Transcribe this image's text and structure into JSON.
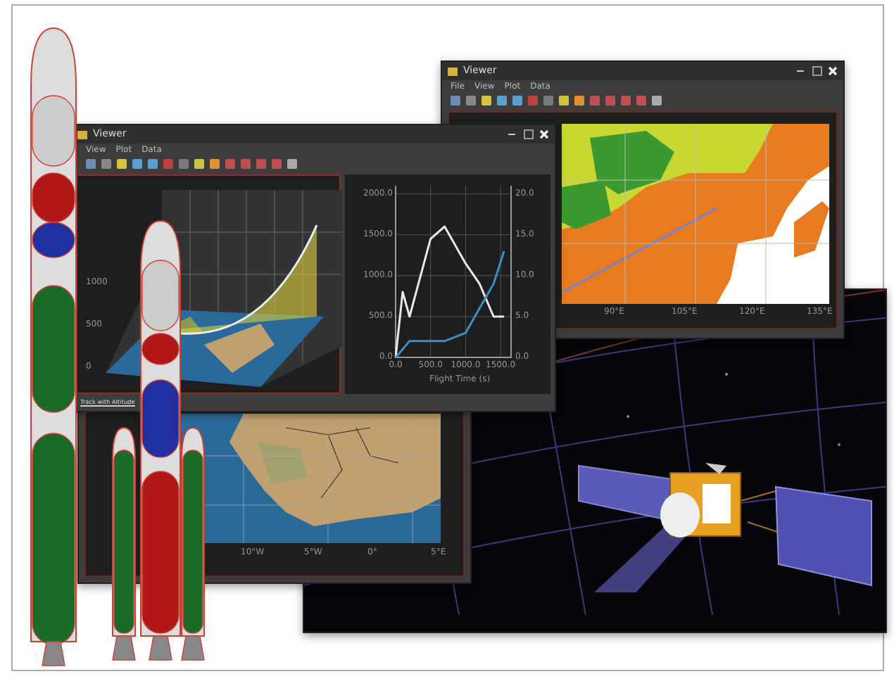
{
  "back_window": {
    "title": "Viewer",
    "menu": [
      "File",
      "View",
      "Plot",
      "Data"
    ],
    "map_xticks": [
      "90°E",
      "105°E",
      "120°E",
      "135°E"
    ]
  },
  "map_window": {
    "map_xticks": [
      "10°W",
      "5°W",
      "0°",
      "5°E"
    ]
  },
  "front_window": {
    "title": "Viewer",
    "menu": [
      "View",
      "Plot",
      "Data"
    ],
    "surface_plot": {
      "zticks": [
        "1000",
        "500",
        "0"
      ]
    },
    "line_plot": {
      "chart_data": {
        "type": "line",
        "grid": true,
        "xlabel": "Flight Time (s)",
        "x": [
          0,
          100,
          200,
          500,
          700,
          1000,
          1200,
          1400,
          1550
        ],
        "series": [
          {
            "color": "#e8e8e8",
            "values": [
              0,
              800,
              500,
              1450,
              1600,
              1150,
              900,
              500,
              500
            ]
          },
          {
            "color": "#3a8fc4",
            "axis": "y2",
            "values": [
              0,
              1,
              2,
              2,
              2,
              3,
              6,
              9,
              13
            ]
          }
        ],
        "xticks": [
          {
            "value": 0,
            "label": "0.0"
          },
          {
            "value": 500,
            "label": "500.0"
          },
          {
            "value": 1000,
            "label": "1000.0"
          },
          {
            "value": 1500,
            "label": "1500.0"
          }
        ],
        "yticks": [
          {
            "value": 0,
            "label": "0.0"
          },
          {
            "value": 500,
            "label": "500.0"
          },
          {
            "value": 1000,
            "label": "1000.0"
          },
          {
            "value": 1500,
            "label": "1500.0"
          },
          {
            "value": 2000,
            "label": "2000.0"
          }
        ],
        "y2ticks": [
          {
            "value": 0,
            "label": "0.0"
          },
          {
            "value": 5,
            "label": "5.0"
          },
          {
            "value": 10,
            "label": "10.0"
          },
          {
            "value": 15,
            "label": "15.0"
          },
          {
            "value": 20,
            "label": "20.0"
          }
        ],
        "xlim": [
          0,
          1650
        ],
        "ylim": [
          0,
          2100
        ],
        "y2lim": [
          0,
          21
        ]
      }
    },
    "tab": "Track with Altitude"
  }
}
